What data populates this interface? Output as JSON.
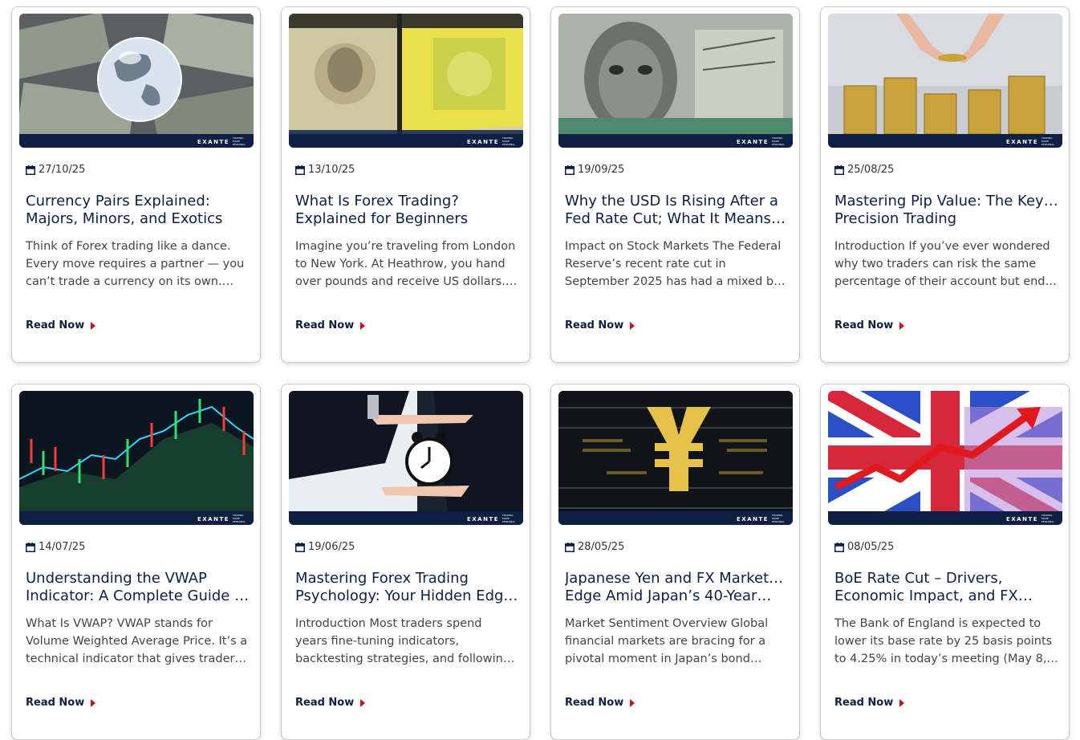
{
  "brand": {
    "name": "EXANTE",
    "tagline": "TRADING MADE PERSONAL"
  },
  "read_label": "Read Now",
  "colors": {
    "navy": "#0d1f42",
    "accent": "#c8102e"
  },
  "cards": [
    {
      "date": "27/10/25",
      "title1": "Currency Pairs Explained:",
      "title2": "Majors, Minors, and Exotics",
      "ex1": "Think of Forex trading like a dance.",
      "ex2": "Every move requires a partner — you",
      "ex3": "can’t trade a currency on its own.…",
      "image": "globe-on-banknotes"
    },
    {
      "date": "13/10/25",
      "title1": "What Is Forex Trading?",
      "title2": "Explained for Beginners",
      "ex1": "Imagine you’re traveling from London",
      "ex2": "to New York. At Heathrow, you hand",
      "ex3": "over pounds and receive US dollars.…",
      "image": "currency-cube"
    },
    {
      "date": "19/09/25",
      "title1": "Why the USD Is Rising After a",
      "title2": "Fed Rate Cut; What It Means fo…",
      "ex1": "Impact on Stock Markets The Federal",
      "ex2": "Reserve’s recent rate cut in",
      "ex3": "September 2025 has had a mixed b…",
      "image": "dollar-bill-franklin"
    },
    {
      "date": "25/08/25",
      "title1": "Mastering Pip Value: The Key to",
      "title2": "Precision Trading",
      "ex1": "Introduction If you’ve ever wondered",
      "ex2": "why two traders can risk the same",
      "ex3": "percentage of their account but end…",
      "image": "coin-stacks"
    },
    {
      "date": "14/07/25",
      "title1": "Understanding the VWAP",
      "title2": "Indicator: A Complete Guide fo…",
      "ex1": "What Is VWAP? VWAP stands for",
      "ex2": "Volume Weighted Average Price. It’s a",
      "ex3": "technical indicator that gives trader…",
      "image": "candlestick-chart"
    },
    {
      "date": "19/06/25",
      "title1": "Mastering Forex Trading",
      "title2": "Psychology: Your Hidden Edge …",
      "ex1": "Introduction Most traders spend",
      "ex2": "years fine-tuning indicators,",
      "ex3": "backtesting strategies, and following…",
      "image": "alarm-clock-hands"
    },
    {
      "date": "28/05/25",
      "title1": "Japanese Yen and FX Markets on",
      "title2": "Edge Amid Japan’s 40-Year…",
      "ex1": "Market Sentiment Overview Global",
      "ex2": "financial markets are bracing for a",
      "ex3": "pivotal moment in Japan’s bond…",
      "image": "yen-digital"
    },
    {
      "date": "08/05/25",
      "title1": "BoE Rate Cut – Drivers,",
      "title2": "Economic Impact, and FX…",
      "ex1": "The Bank of England is expected to",
      "ex2": "lower its base rate by 25 basis points",
      "ex3": "to 4.25% in today’s meeting (May 8,…",
      "image": "union-jack-arrow"
    }
  ]
}
